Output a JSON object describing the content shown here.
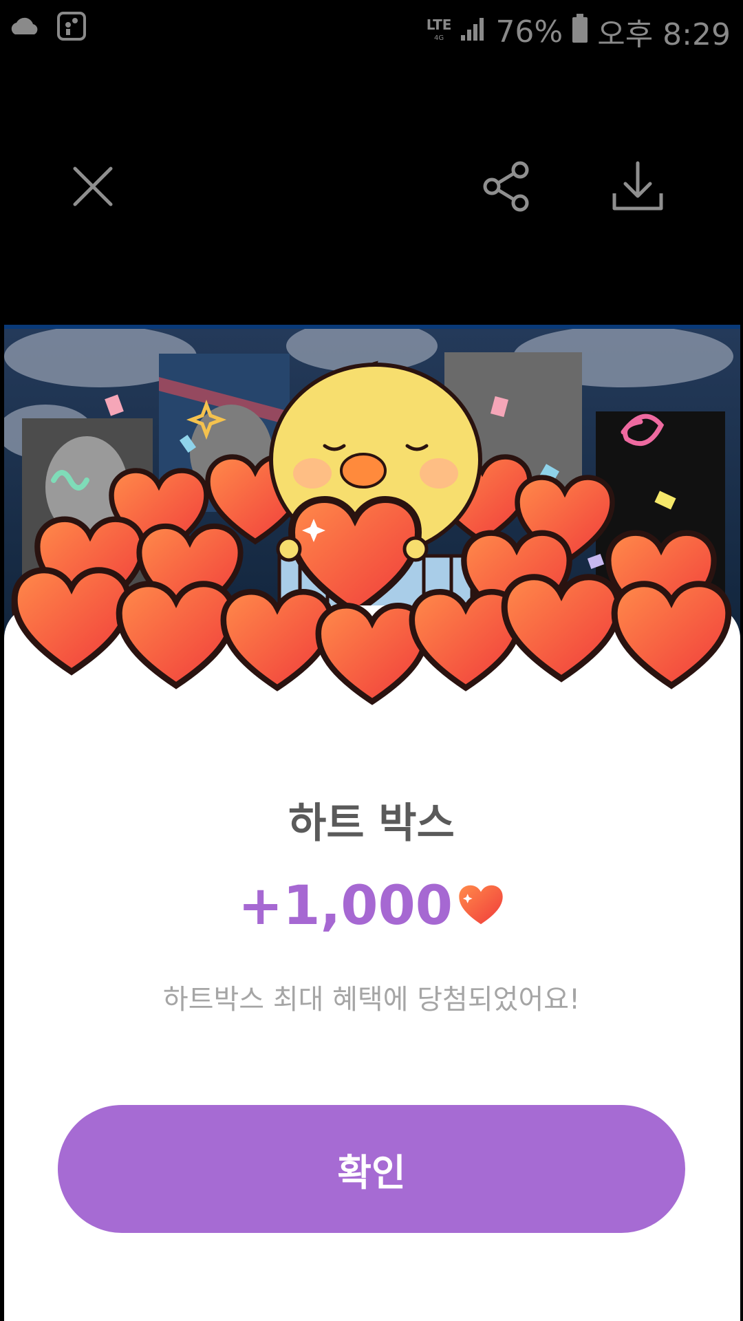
{
  "status_bar": {
    "network": "LTE",
    "network_sub": "4G",
    "battery": "76%",
    "time": "오후 8:29",
    "icons": [
      "cloud-icon",
      "app-notification-icon",
      "signal-icon",
      "battery-icon"
    ]
  },
  "toolbar": {
    "icons": [
      "close-icon",
      "share-icon",
      "download-icon"
    ]
  },
  "reward": {
    "title": "하트 박스",
    "amount": "+1,000",
    "icon": "heart-icon",
    "description": "하트박스 최대 혜택에 당첨되었어요!"
  },
  "confirm_button": {
    "label": "확인"
  },
  "colors": {
    "accent": "#a66bd3",
    "amount": "#a668d2",
    "title": "#5a5a5a",
    "description": "#a5a5a5",
    "heart": "#ff5a3c",
    "chick": "#f7de6e"
  }
}
